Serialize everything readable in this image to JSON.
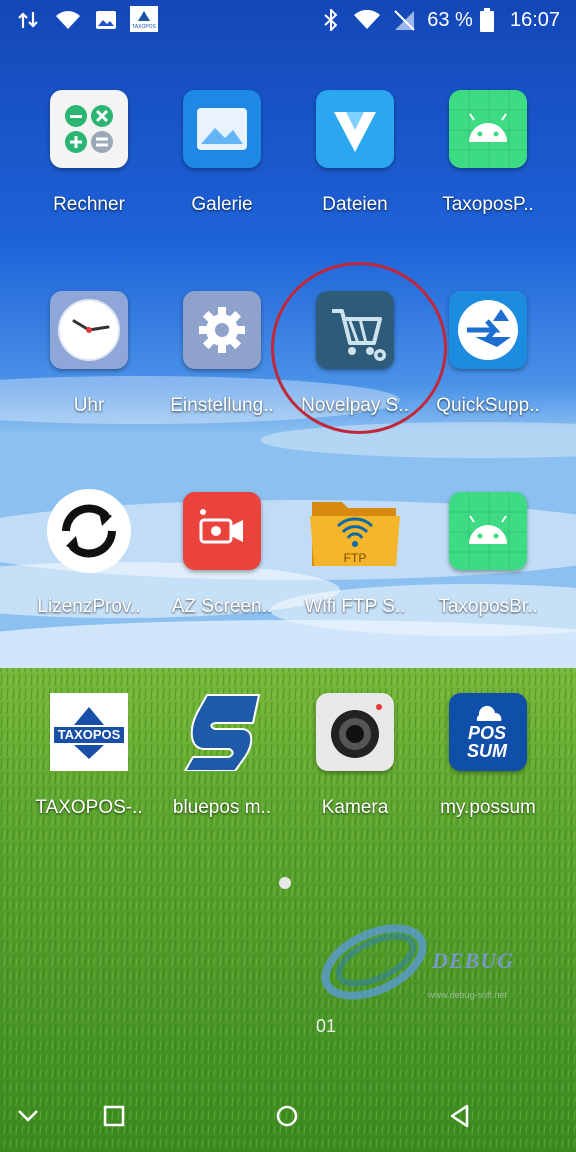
{
  "status_bar": {
    "battery_percent": "63 %",
    "time": "16:07",
    "icons": [
      "data-transfer-icon",
      "wifi-icon",
      "gallery-notification-icon",
      "taxopos-notification-icon",
      "bluetooth-icon",
      "wifi-signal-icon",
      "no-sim-icon",
      "battery-icon"
    ],
    "taxopos_mini_label": "TAXOPOS"
  },
  "apps": [
    {
      "label": "Rechner",
      "icon": "calculator-icon"
    },
    {
      "label": "Galerie",
      "icon": "gallery-icon"
    },
    {
      "label": "Dateien",
      "icon": "files-icon"
    },
    {
      "label": "TaxoposP..",
      "icon": "android-icon"
    },
    {
      "label": "Uhr",
      "icon": "clock-icon"
    },
    {
      "label": "Einstellung..",
      "icon": "settings-icon"
    },
    {
      "label": "Novelpay S..",
      "icon": "novelpay-cart-icon"
    },
    {
      "label": "QuickSupp..",
      "icon": "quicksupport-icon"
    },
    {
      "label": "LizenzProv..",
      "icon": "sync-icon"
    },
    {
      "label": "AZ Screen..",
      "icon": "screen-recorder-icon"
    },
    {
      "label": "Wifi FTP S..",
      "icon": "wifi-ftp-folder-icon"
    },
    {
      "label": "TaxoposBr..",
      "icon": "android-icon"
    },
    {
      "label": "TAXOPOS-..",
      "icon": "taxopos-icon"
    },
    {
      "label": "bluepos m..",
      "icon": "bluepos-icon"
    },
    {
      "label": "Kamera",
      "icon": "camera-icon"
    },
    {
      "label": "my.possum",
      "icon": "possum-icon"
    }
  ],
  "app_icon_text": {
    "taxopos": "TAXOPOS",
    "possum_line1": "POS",
    "possum_line2": "SUM",
    "ftp": "FTP"
  },
  "watermark": {
    "text": "DEBUG",
    "subtext": "www.debug-soft.net"
  },
  "home_screen_number": "01",
  "nav_bar": {
    "buttons": [
      "collapse-chevron-icon",
      "recents-square-icon",
      "home-circle-icon",
      "back-triangle-icon"
    ]
  },
  "colors": {
    "sky_top": "#1a4fc4",
    "sky_mid": "#3a86e6",
    "grass": "#4c9a2a",
    "highlight_ring": "#c0283a"
  }
}
